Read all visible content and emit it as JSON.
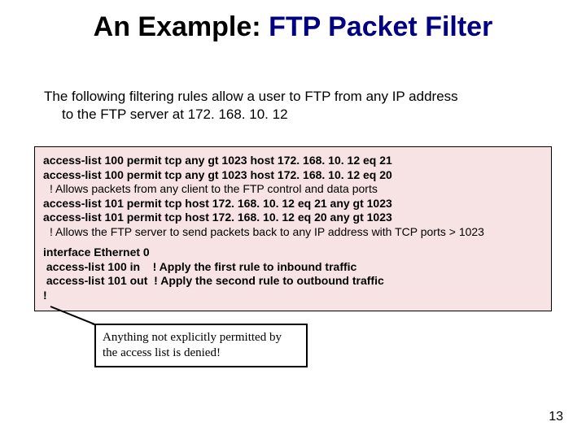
{
  "title_black": "An Example:",
  "title_blue": "FTP Packet Filter",
  "intro_line1": "The following filtering rules allow a user to FTP from any IP address",
  "intro_line2": "to the FTP server at 172. 168. 10. 12",
  "code": {
    "l1": "access-list 100 permit tcp any gt 1023 host 172. 168. 10. 12 eq 21",
    "l2": "access-list 100 permit tcp any gt 1023 host 172. 168. 10. 12 eq 20",
    "c1": "! Allows packets from any client to the FTP control and data ports",
    "l3": "access-list 101 permit tcp host 172. 168. 10. 12 eq 21 any gt 1023",
    "l4": "access-list 101 permit tcp host 172. 168. 10. 12 eq 20 any gt 1023",
    "c2": "! Allows the FTP server to send packets back to any IP address with TCP ports > 1023",
    "l5": "interface Ethernet 0",
    "l6": " access-list 100 in    ! Apply the first rule to inbound traffic",
    "l7": " access-list 101 out  ! Apply the second rule to outbound traffic",
    "l8": "!"
  },
  "note": "Anything not explicitly permitted by the access list is denied!",
  "page": "13"
}
